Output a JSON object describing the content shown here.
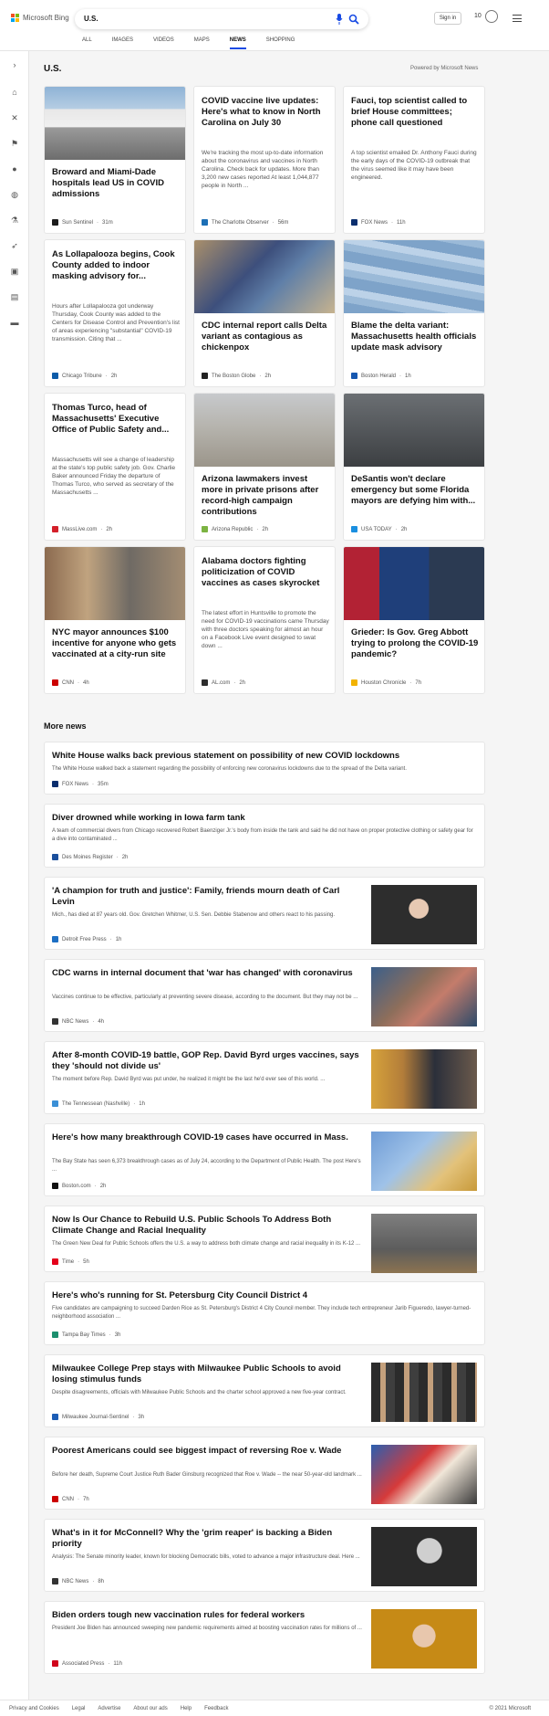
{
  "brand": {
    "name": "Microsoft Bing",
    "colors": [
      "#f25022",
      "#7fba00",
      "#00a4ef",
      "#ffb900"
    ]
  },
  "search": {
    "query": "U.S."
  },
  "header": {
    "signin_label": "Sign in",
    "rewards_count": "10"
  },
  "tabs": [
    "ALL",
    "IMAGES",
    "VIDEOS",
    "MAPS",
    "NEWS",
    "SHOPPING"
  ],
  "active_tab": "NEWS",
  "region": {
    "title": "U.S.",
    "powered_by": "Powered by Microsoft News"
  },
  "sidebar_icons": [
    "expand-icon",
    "home-icon",
    "sports-icon",
    "flag-icon",
    "location-icon",
    "globe-icon",
    "science-icon",
    "rocket-icon",
    "entertainment-icon",
    "money-icon",
    "card-icon"
  ],
  "cards": [
    {
      "title": "Broward and Miami-Dade hospitals lead US in COVID admissions",
      "snippet": "",
      "source": "Sun Sentinel",
      "time": "31m",
      "favicon_color": "#1b1b1b",
      "image": "tent"
    },
    {
      "title": "COVID vaccine live updates: Here's what to know in North Carolina on July 30",
      "snippet": "We're tracking the most up-to-date information about the coronavirus and vaccines in North Carolina. Check back for updates. More than 3,200 new cases reported At least 1,044,877 people in North ...",
      "source": "The Charlotte Observer",
      "time": "56m",
      "favicon_color": "#1c6fb5",
      "image": ""
    },
    {
      "title": "Fauci, top scientist called to brief House committees; phone call questioned",
      "snippet": "A top scientist emailed Dr. Anthony Fauci during the early days of the COVID-19 outbreak that the virus seemed like it may have been engineered.",
      "source": "FOX News",
      "time": "11h",
      "favicon_color": "#0a2e6e",
      "image": ""
    },
    {
      "title": "As Lollapalooza begins, Cook County added to indoor masking advisory for...",
      "snippet": "Hours after Lollapalooza got underway Thursday, Cook County was added to the Centers for Disease Control and Prevention's list of areas experiencing \"substantial\" COVID-19 transmission. Citing that ...",
      "source": "Chicago Tribune",
      "time": "2h",
      "favicon_color": "#0c5ba8",
      "image": ""
    },
    {
      "title": "CDC internal report calls Delta variant as contagious as chickenpox",
      "snippet": "",
      "source": "The Boston Globe",
      "time": "2h",
      "favicon_color": "#222222",
      "image": "vaccination"
    },
    {
      "title": "Blame the delta variant: Massachusetts health officials update mask advisory",
      "snippet": "",
      "source": "Boston Herald",
      "time": "1h",
      "favicon_color": "#1657b0",
      "image": "masks"
    },
    {
      "title": "Thomas Turco, head of Massachusetts' Executive Office of Public Safety and...",
      "snippet": "Massachusetts will see a change of leadership at the state's top public safety job. Gov. Charlie Baker announced Friday the departure of Thomas Turco, who served as secretary of the Massachusetts ...",
      "source": "MassLive.com",
      "time": "2h",
      "favicon_color": "#d4202a",
      "image": ""
    },
    {
      "title": "Arizona lawmakers invest more in private prisons after record-high campaign contributions",
      "snippet": "",
      "source": "Arizona Republic",
      "time": "2h",
      "favicon_color": "#7cb342",
      "image": "prison"
    },
    {
      "title": "DeSantis won't declare emergency but some Florida mayors are defying him with...",
      "snippet": "",
      "source": "USA TODAY",
      "time": "2h",
      "favicon_color": "#1a8fe0",
      "image": "notice"
    },
    {
      "title": "NYC mayor announces $100 incentive for anyone who gets vaccinated at a city-run site",
      "snippet": "",
      "source": "CNN",
      "time": "4h",
      "favicon_color": "#cc0000",
      "image": "mayor"
    },
    {
      "title": "Alabama doctors fighting politicization of COVID vaccines as cases skyrocket",
      "snippet": "The latest effort in Huntsville to promote the need for COVID-19 vaccinations came Thursday with three doctors speaking for almost an hour on a Facebook Live event designed to swat down ...",
      "source": "AL.com",
      "time": "2h",
      "favicon_color": "#2d2d2d",
      "image": ""
    },
    {
      "title": "Grieder: Is Gov. Greg Abbott trying to prolong the COVID-19 pandemic?",
      "snippet": "",
      "source": "Houston Chronicle",
      "time": "7h",
      "favicon_color": "#f2b300",
      "image": "abbott"
    }
  ],
  "more_news_label": "More news",
  "more_news": [
    {
      "title": "White House walks back previous statement on possibility of new COVID lockdowns",
      "snippet": "The White House walked back a statement regarding the possibility of enforcing new coronavirus lockdowns due to the spread of the Delta variant.",
      "source": "FOX News",
      "time": "35m",
      "favicon_color": "#0a2e6e",
      "thumb": ""
    },
    {
      "title": "Diver drowned while working in Iowa farm tank",
      "snippet": "A team of commercial divers from Chicago recovered Robert Baenziger Jr.'s body from inside the tank and said he did not have on proper protective clothing or safety gear for a dive into contaminated ...",
      "source": "Des Moines Register",
      "time": "2h",
      "favicon_color": "#1b4f9c",
      "thumb": ""
    },
    {
      "title": "'A champion for truth and justice': Family, friends mourn death of Carl Levin",
      "snippet": "Mich., has died at 87 years old. Gov. Gretchen Whitmer, U.S. Sen. Debbie Stabenow and others react to his passing.",
      "source": "Detroit Free Press",
      "time": "1h",
      "favicon_color": "#1d6fc4",
      "thumb": "levin"
    },
    {
      "title": "CDC warns in internal document that 'war has changed' with coronavirus",
      "snippet": "Vaccines continue to be effective, particularly at preventing severe disease, according to the document. But they may not be ...",
      "source": "NBC News",
      "time": "4h",
      "favicon_color": "#333333",
      "thumb": "crowd"
    },
    {
      "title": "After 8-month COVID-19 battle, GOP Rep. David Byrd urges vaccines, says they 'should not divide us'",
      "snippet": "The moment before Rep. David Byrd was put under, he realized it might be the last he'd ever see of this world. ...",
      "source": "The Tennessean (Nashville)",
      "time": "1h",
      "favicon_color": "#3a8fd6",
      "thumb": "byrd"
    },
    {
      "title": "Here's how many breakthrough COVID-19 cases have occurred in Mass.",
      "snippet": "The Bay State has seen 6,373 breakthrough cases as of July 24, according to the Department of Public Health. The post Here's ...",
      "source": "Boston.com",
      "time": "2h",
      "favicon_color": "#111111",
      "thumb": "gloves"
    },
    {
      "title": "Now Is Our Chance to Rebuild U.S. Public Schools To Address Both Climate Change and Racial Inequality",
      "snippet": "The Green New Deal for Public Schools offers the U.S. a way to address both climate change and racial inequality in its K-12 ...",
      "source": "Time",
      "time": "5h",
      "favicon_color": "#e4001b",
      "thumb": "school"
    },
    {
      "title": "Here's who's running for St. Petersburg City Council District 4",
      "snippet": "Five candidates are campaigning to succeed Darden Rice as St. Petersburg's District 4 City Council member. They include tech entrepreneur Jarib Figueredo, lawyer-turned-neighborhood association ...",
      "source": "Tampa Bay Times",
      "time": "3h",
      "favicon_color": "#1c8f6e",
      "thumb": ""
    },
    {
      "title": "Milwaukee College Prep stays with Milwaukee Public Schools to avoid losing stimulus funds",
      "snippet": "Despite disagreements, officials with Milwaukee Public Schools and the charter school approved a new five-year contract.",
      "source": "Milwaukee Journal-Sentinel",
      "time": "3h",
      "favicon_color": "#1d5db5",
      "thumb": "students"
    },
    {
      "title": "Poorest Americans could see biggest impact of reversing Roe v. Wade",
      "snippet": "Before her death, Supreme Court Justice Ruth Bader Ginsburg recognized that Roe v. Wade -- the near 50-year-old landmark ...",
      "source": "CNN",
      "time": "7h",
      "favicon_color": "#cc0000",
      "thumb": "protest"
    },
    {
      "title": "What's in it for McConnell? Why the 'grim reaper' is backing a Biden priority",
      "snippet": "Analysis: The Senate minority leader, known for blocking Democratic bills, voted to advance a major infrastructure deal. Here ...",
      "source": "NBC News",
      "time": "8h",
      "favicon_color": "#333333",
      "thumb": "mcconnell"
    },
    {
      "title": "Biden orders tough new vaccination rules for federal workers",
      "snippet": "President Joe Biden has announced sweeping new pandemic requirements aimed at boosting vaccination rates for millions of ...",
      "source": "Associated Press",
      "time": "11h",
      "favicon_color": "#d0021b",
      "thumb": "biden"
    }
  ],
  "footer": {
    "links": [
      "Privacy and Cookies",
      "Legal",
      "Advertise",
      "About our ads",
      "Help",
      "Feedback"
    ],
    "copyright": "© 2021 Microsoft"
  }
}
